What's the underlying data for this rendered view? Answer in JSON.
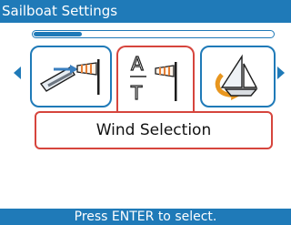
{
  "title": "Sailboat Settings",
  "progress": 0.2,
  "carousel": {
    "items": [
      {
        "name": "wind-tracking-tile",
        "icon": "sailboat-wind-icon"
      },
      {
        "name": "wind-selection-tile",
        "icon": "apparent-true-wind-icon",
        "selected": true
      },
      {
        "name": "tack-tile",
        "icon": "sailboat-tack-icon"
      }
    ],
    "selected_label": "Wind Selection",
    "center_icon_letters": {
      "top": "A",
      "bottom": "T"
    }
  },
  "footer_hint": "Press ENTER to select.",
  "colors": {
    "accent": "#1f7ab8",
    "highlight": "#d6453d"
  }
}
